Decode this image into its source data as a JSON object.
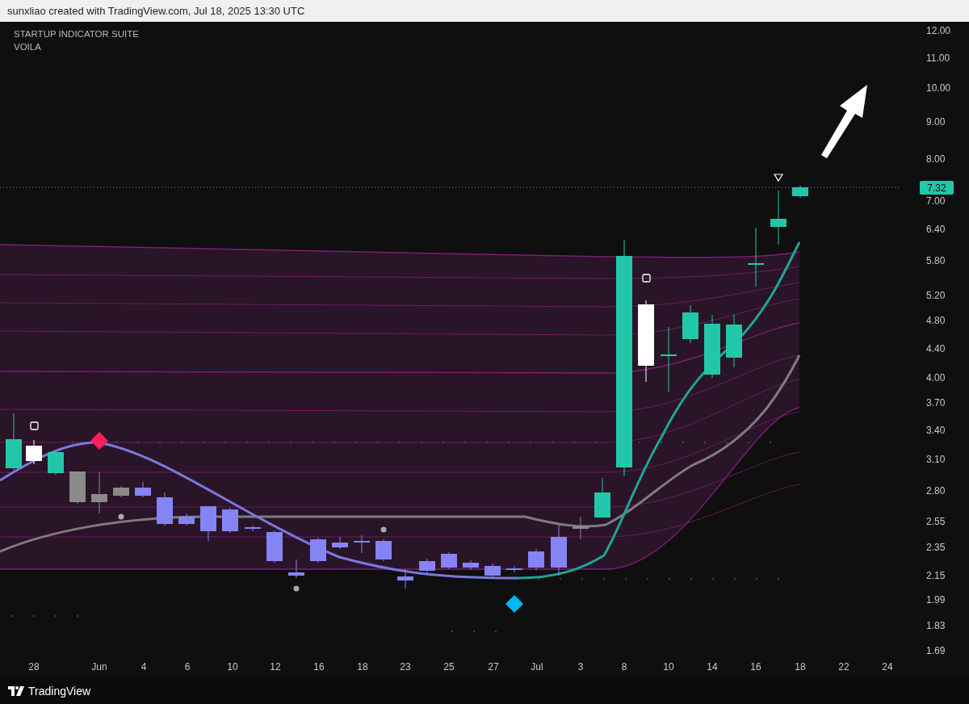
{
  "header": {
    "text": "sunxliao created with TradingView.com, Jul 18, 2025 13:30 UTC"
  },
  "indicators": [
    "STARTUP INDICATOR SUITE",
    "VOILA"
  ],
  "price_axis": [
    "12.00",
    "11.00",
    "10.00",
    "9.00",
    "8.00",
    "7.00",
    "6.40",
    "5.80",
    "5.20",
    "4.80",
    "4.40",
    "4.00",
    "3.70",
    "3.40",
    "3.10",
    "2.80",
    "2.55",
    "2.35",
    "2.15",
    "1.99",
    "1.83",
    "1.69"
  ],
  "current_price": "7.32",
  "time_axis": [
    "28",
    "Jun",
    "4",
    "6",
    "10",
    "12",
    "16",
    "18",
    "23",
    "25",
    "27",
    "Jul",
    "3",
    "8",
    "10",
    "14",
    "16",
    "18",
    "22",
    "24"
  ],
  "footer": {
    "brand": "TradingView"
  }
}
